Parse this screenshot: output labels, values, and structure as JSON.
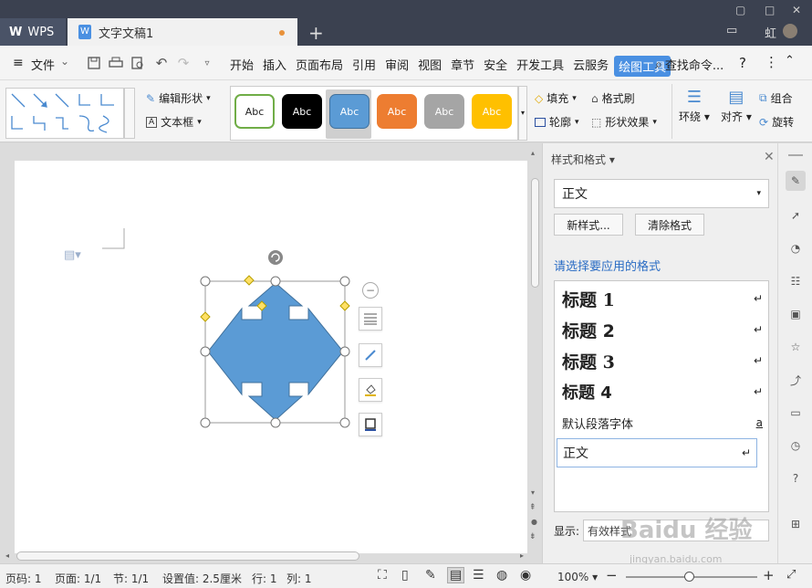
{
  "titlebar": {
    "app_tab": "WPS",
    "doc_tab": "文字文稿1",
    "user": "虹"
  },
  "menubar": {
    "file": "文件",
    "items": [
      "开始",
      "插入",
      "页面布局",
      "引用",
      "审阅",
      "视图",
      "章节",
      "安全",
      "开发工具",
      "云服务"
    ],
    "active": "绘图工具",
    "search": "查找命令...",
    "help": "?"
  },
  "ribbon": {
    "edit_shape": "编辑形状",
    "text_box": "文本框",
    "swatch_label": "Abc",
    "fill": "填充",
    "format_brush": "格式刷",
    "outline": "轮廓",
    "shape_effects": "形状效果",
    "wrap": "环绕",
    "align": "对齐",
    "group": "组合",
    "rotate": "旋转",
    "swatch_colors": [
      "#ffffff",
      "#000000",
      "#5b9bd5",
      "#ed7d31",
      "#a5a5a5",
      "#ffc000"
    ]
  },
  "panel": {
    "title": "样式和格式",
    "current_style": "正文",
    "new_style": "新样式...",
    "clear_format": "清除格式",
    "prompt": "请选择要应用的格式",
    "styles": [
      {
        "name": "标题  1",
        "mark": "↵"
      },
      {
        "name": "标题  2",
        "mark": "↵"
      },
      {
        "name": "标题  3",
        "mark": "↵"
      },
      {
        "name": "标题  4",
        "mark": "↵"
      },
      {
        "name": "默认段落字体",
        "mark": "a"
      },
      {
        "name": "正文",
        "mark": "↵"
      }
    ],
    "show_label": "显示:",
    "show_value": "有效样式"
  },
  "statusbar": {
    "page_no": "页码: 1",
    "page_count": "页面: 1/1",
    "section": "节: 1/1",
    "setting": "设置值: 2.5厘米",
    "row": "行: 1",
    "col": "列: 1",
    "zoom": "100%"
  },
  "watermark": {
    "text": "Baidu 经验",
    "url": "jingyan.baidu.com"
  },
  "colors": {
    "accent": "#4a90e2",
    "shape_fill": "#5b9bd5",
    "titlebar": "#3b4150"
  }
}
